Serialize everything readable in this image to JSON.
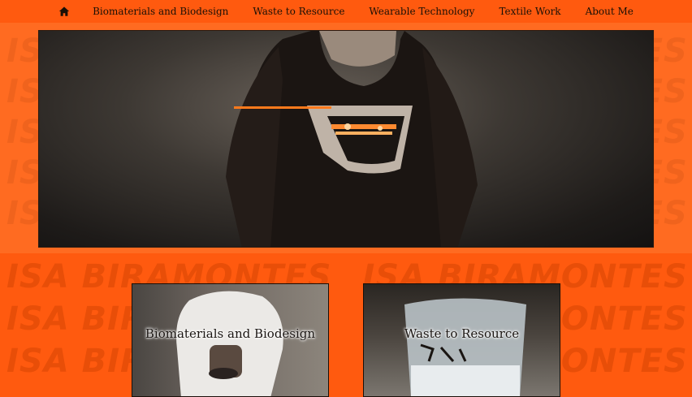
{
  "nav": {
    "home_icon": "home-icon",
    "items": [
      "Biomaterials and Biodesign",
      "Waste to Resource",
      "Wearable Technology",
      "Textile Work",
      "About Me"
    ]
  },
  "background": {
    "watermark_text": "ISA BIRAMONTES",
    "accent_color": "#ff5a0f"
  },
  "cards": [
    {
      "title": "Biomaterials and Biodesign"
    },
    {
      "title": "Waste to Resource"
    }
  ]
}
